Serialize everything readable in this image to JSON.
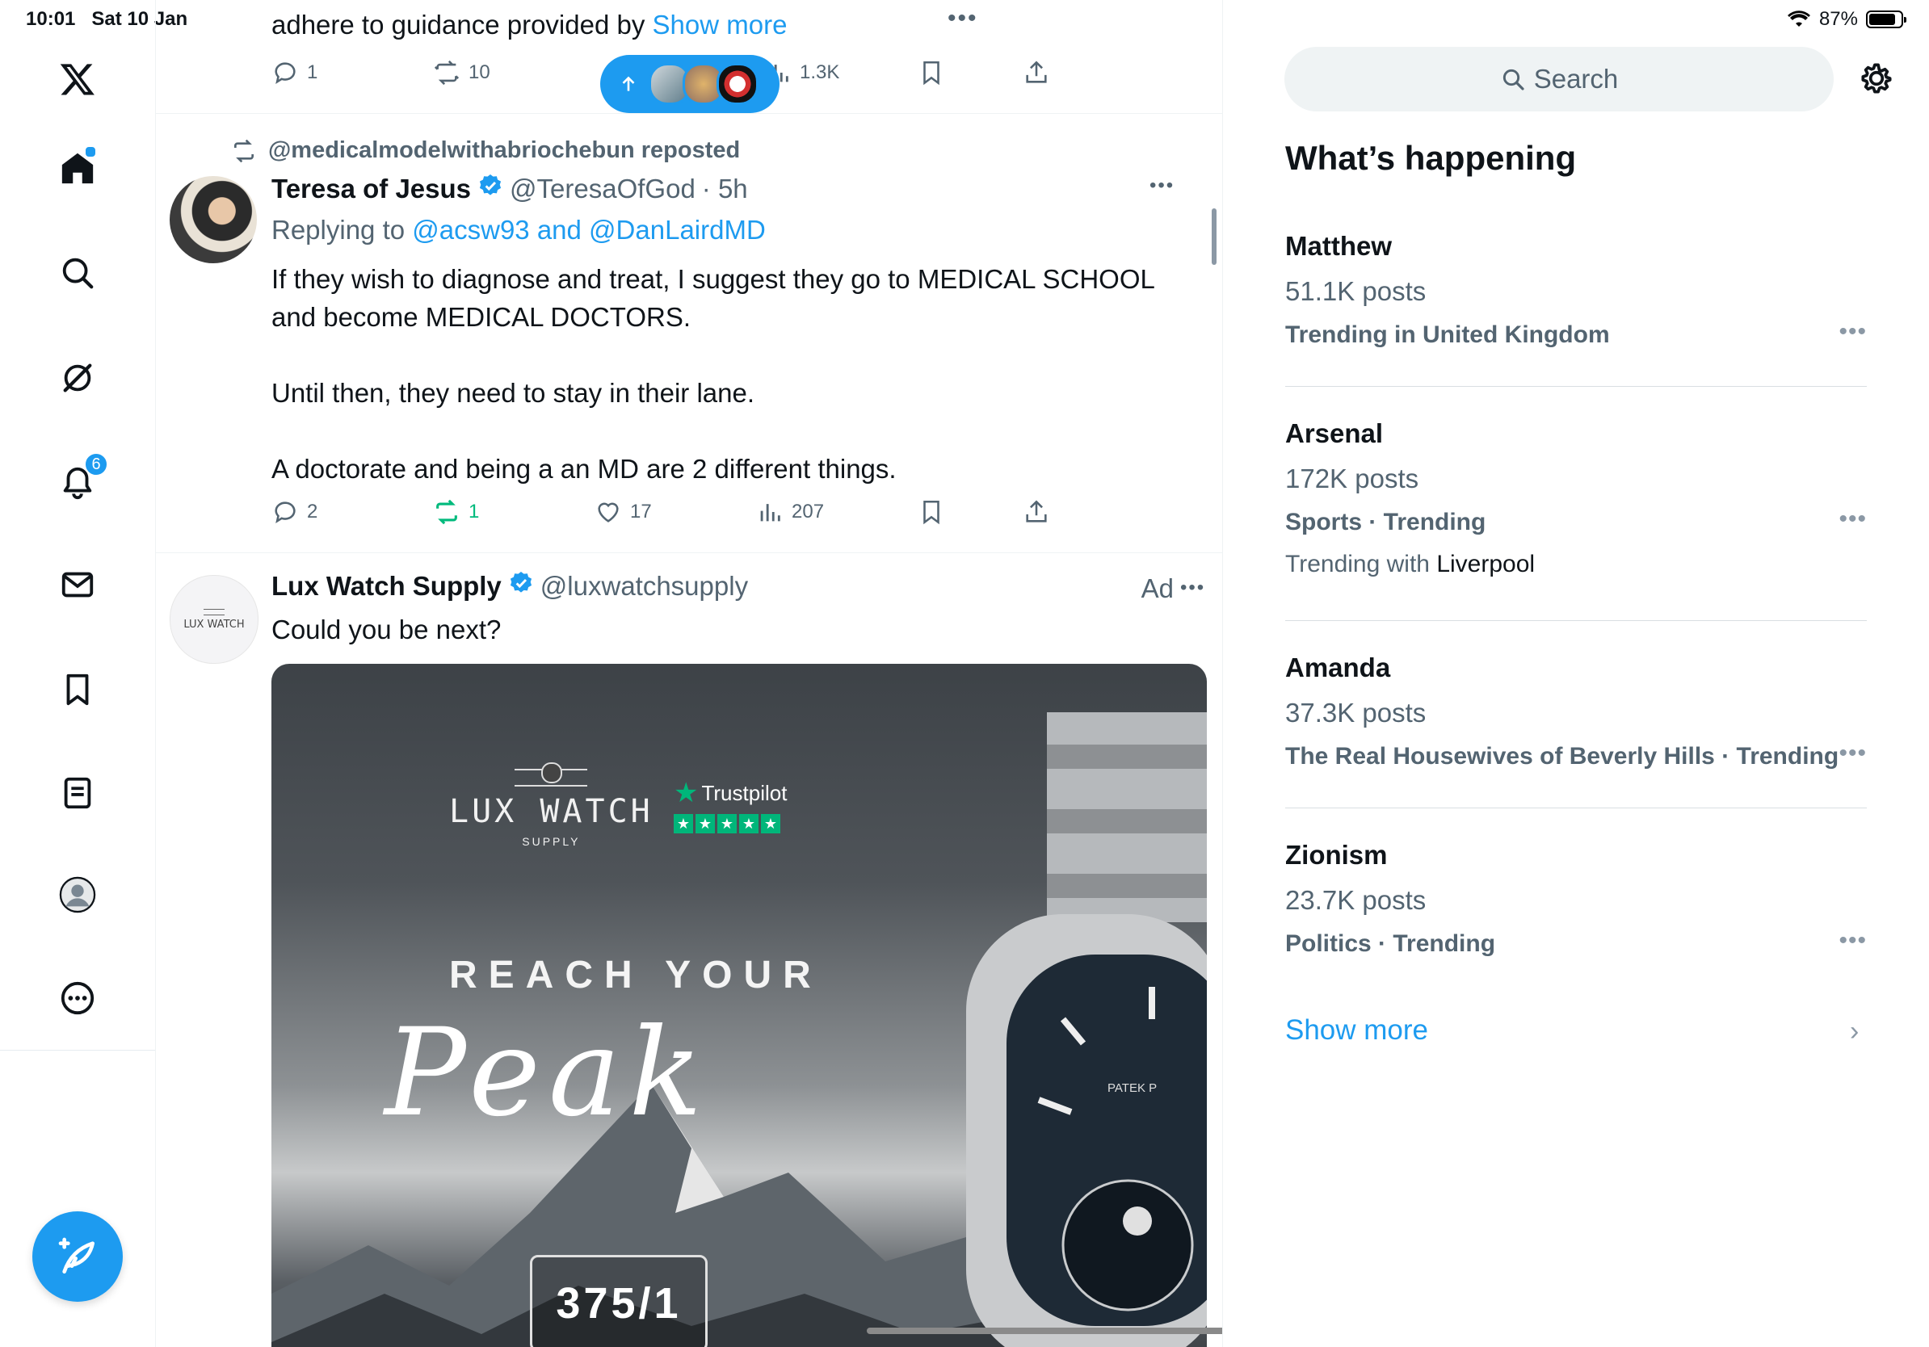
{
  "status_bar": {
    "time": "10:01",
    "date": "Sat 10 Jan",
    "battery": "87%"
  },
  "nav": {
    "notifications_badge": "6",
    "items": [
      "x-logo-icon",
      "home-icon",
      "search-icon",
      "grok-icon",
      "notifications-icon",
      "messages-icon",
      "bookmarks-icon",
      "lists-icon",
      "profile-icon",
      "more-icon"
    ]
  },
  "feed": {
    "top_tweet": {
      "text_partial": "adhere to guidance provided by ",
      "show_more": "Show more",
      "replies": "1",
      "reposts": "10",
      "views": "1.3K"
    },
    "tweet1": {
      "repost_by": "@medicalmodelwithabriochebun reposted",
      "name": "Teresa of Jesus",
      "handle": "@TeresaOfGod",
      "time": "· 5h",
      "replying_prefix": "Replying to ",
      "replying_to": "@acsw93 and @DanLairdMD",
      "body": "If they wish to diagnose and treat, I suggest they go to MEDICAL SCHOOL and become MEDICAL DOCTORS.\n\nUntil then, they need to stay in their lane.\n\nA doctorate and being a an MD are 2 different things.",
      "replies": "2",
      "reposts": "1",
      "likes": "17",
      "views": "207"
    },
    "ad": {
      "name": "Lux Watch Supply",
      "handle": "@luxwatchsupply",
      "ad_label": "Ad",
      "body": "Could you be next?",
      "avatar_text": "LUX WATCH",
      "logo_title": "LUX WATCH",
      "logo_sub": "SUPPLY",
      "trustpilot": "Trustpilot",
      "headline": "REACH YOUR",
      "script": "Peak",
      "code": "375/1",
      "watch_brand": "PATEK P"
    }
  },
  "sidebar": {
    "search_placeholder": "Search",
    "section_title": "What’s happening",
    "trends": [
      {
        "name": "Matthew",
        "posts": "51.1K posts",
        "context": "Trending in United Kingdom"
      },
      {
        "name": "Arsenal",
        "posts": "172K posts",
        "context": "Sports · Trending",
        "with_prefix": "Trending with ",
        "with": "Liverpool"
      },
      {
        "name": "Amanda",
        "posts": "37.3K posts",
        "context": "The Real Housewives of Beverly Hills · Trending"
      },
      {
        "name": "Zionism",
        "posts": "23.7K posts",
        "context": "Politics · Trending"
      }
    ],
    "show_more": "Show more"
  },
  "colors": {
    "accent": "#1d9bf0",
    "repost_green": "#00ba7c",
    "muted": "#536471"
  }
}
